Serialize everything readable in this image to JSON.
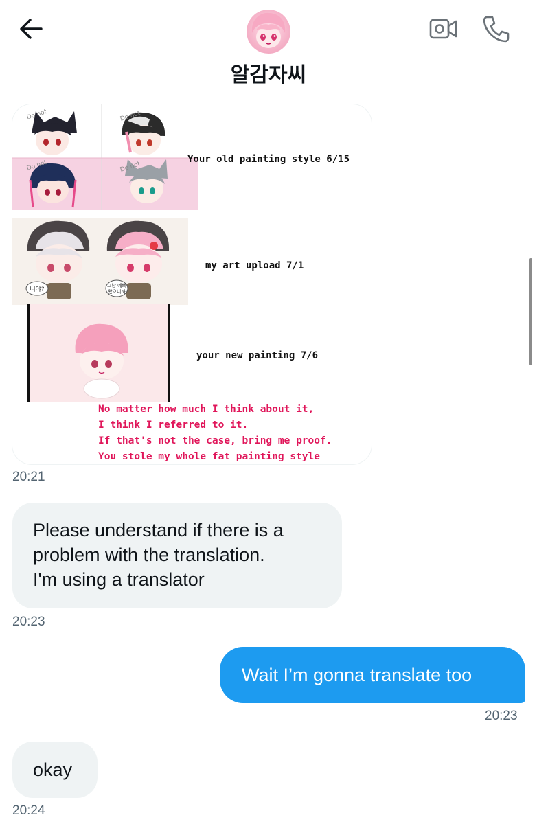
{
  "header": {
    "contact_name": "알감자씨",
    "back_icon": "arrow-left-icon",
    "video_icon": "video-camera-icon",
    "call_icon": "phone-icon"
  },
  "messages": [
    {
      "type": "image",
      "direction": "incoming",
      "captions": {
        "old_style": "Your old painting style 6/15",
        "my_upload": "my art upload 7/1",
        "new_painting": "your new painting 7/6"
      },
      "red_lines": [
        "No matter how much I think about it,",
        "I think I referred to it.",
        "If that's not the case, bring me proof.",
        "You stole my whole fat painting style"
      ],
      "watermark": "Do not",
      "bubble_text": [
        "너야?",
        "그냥 예뻐\n왔으니까"
      ],
      "time": "20:21"
    },
    {
      "type": "text",
      "direction": "incoming",
      "lines": [
        "Please understand if there is a",
        "problem with the translation.",
        "I'm using a translator"
      ],
      "time": "20:23"
    },
    {
      "type": "text",
      "direction": "outgoing",
      "text": "Wait I’m gonna translate too",
      "time": "20:23"
    },
    {
      "type": "text",
      "direction": "incoming",
      "text": "okay",
      "time": "20:24"
    }
  ],
  "colors": {
    "accent": "#1d9bf0",
    "incoming_bubble": "#eff3f4",
    "timestamp": "#536471",
    "red_text": "#e0165a"
  }
}
